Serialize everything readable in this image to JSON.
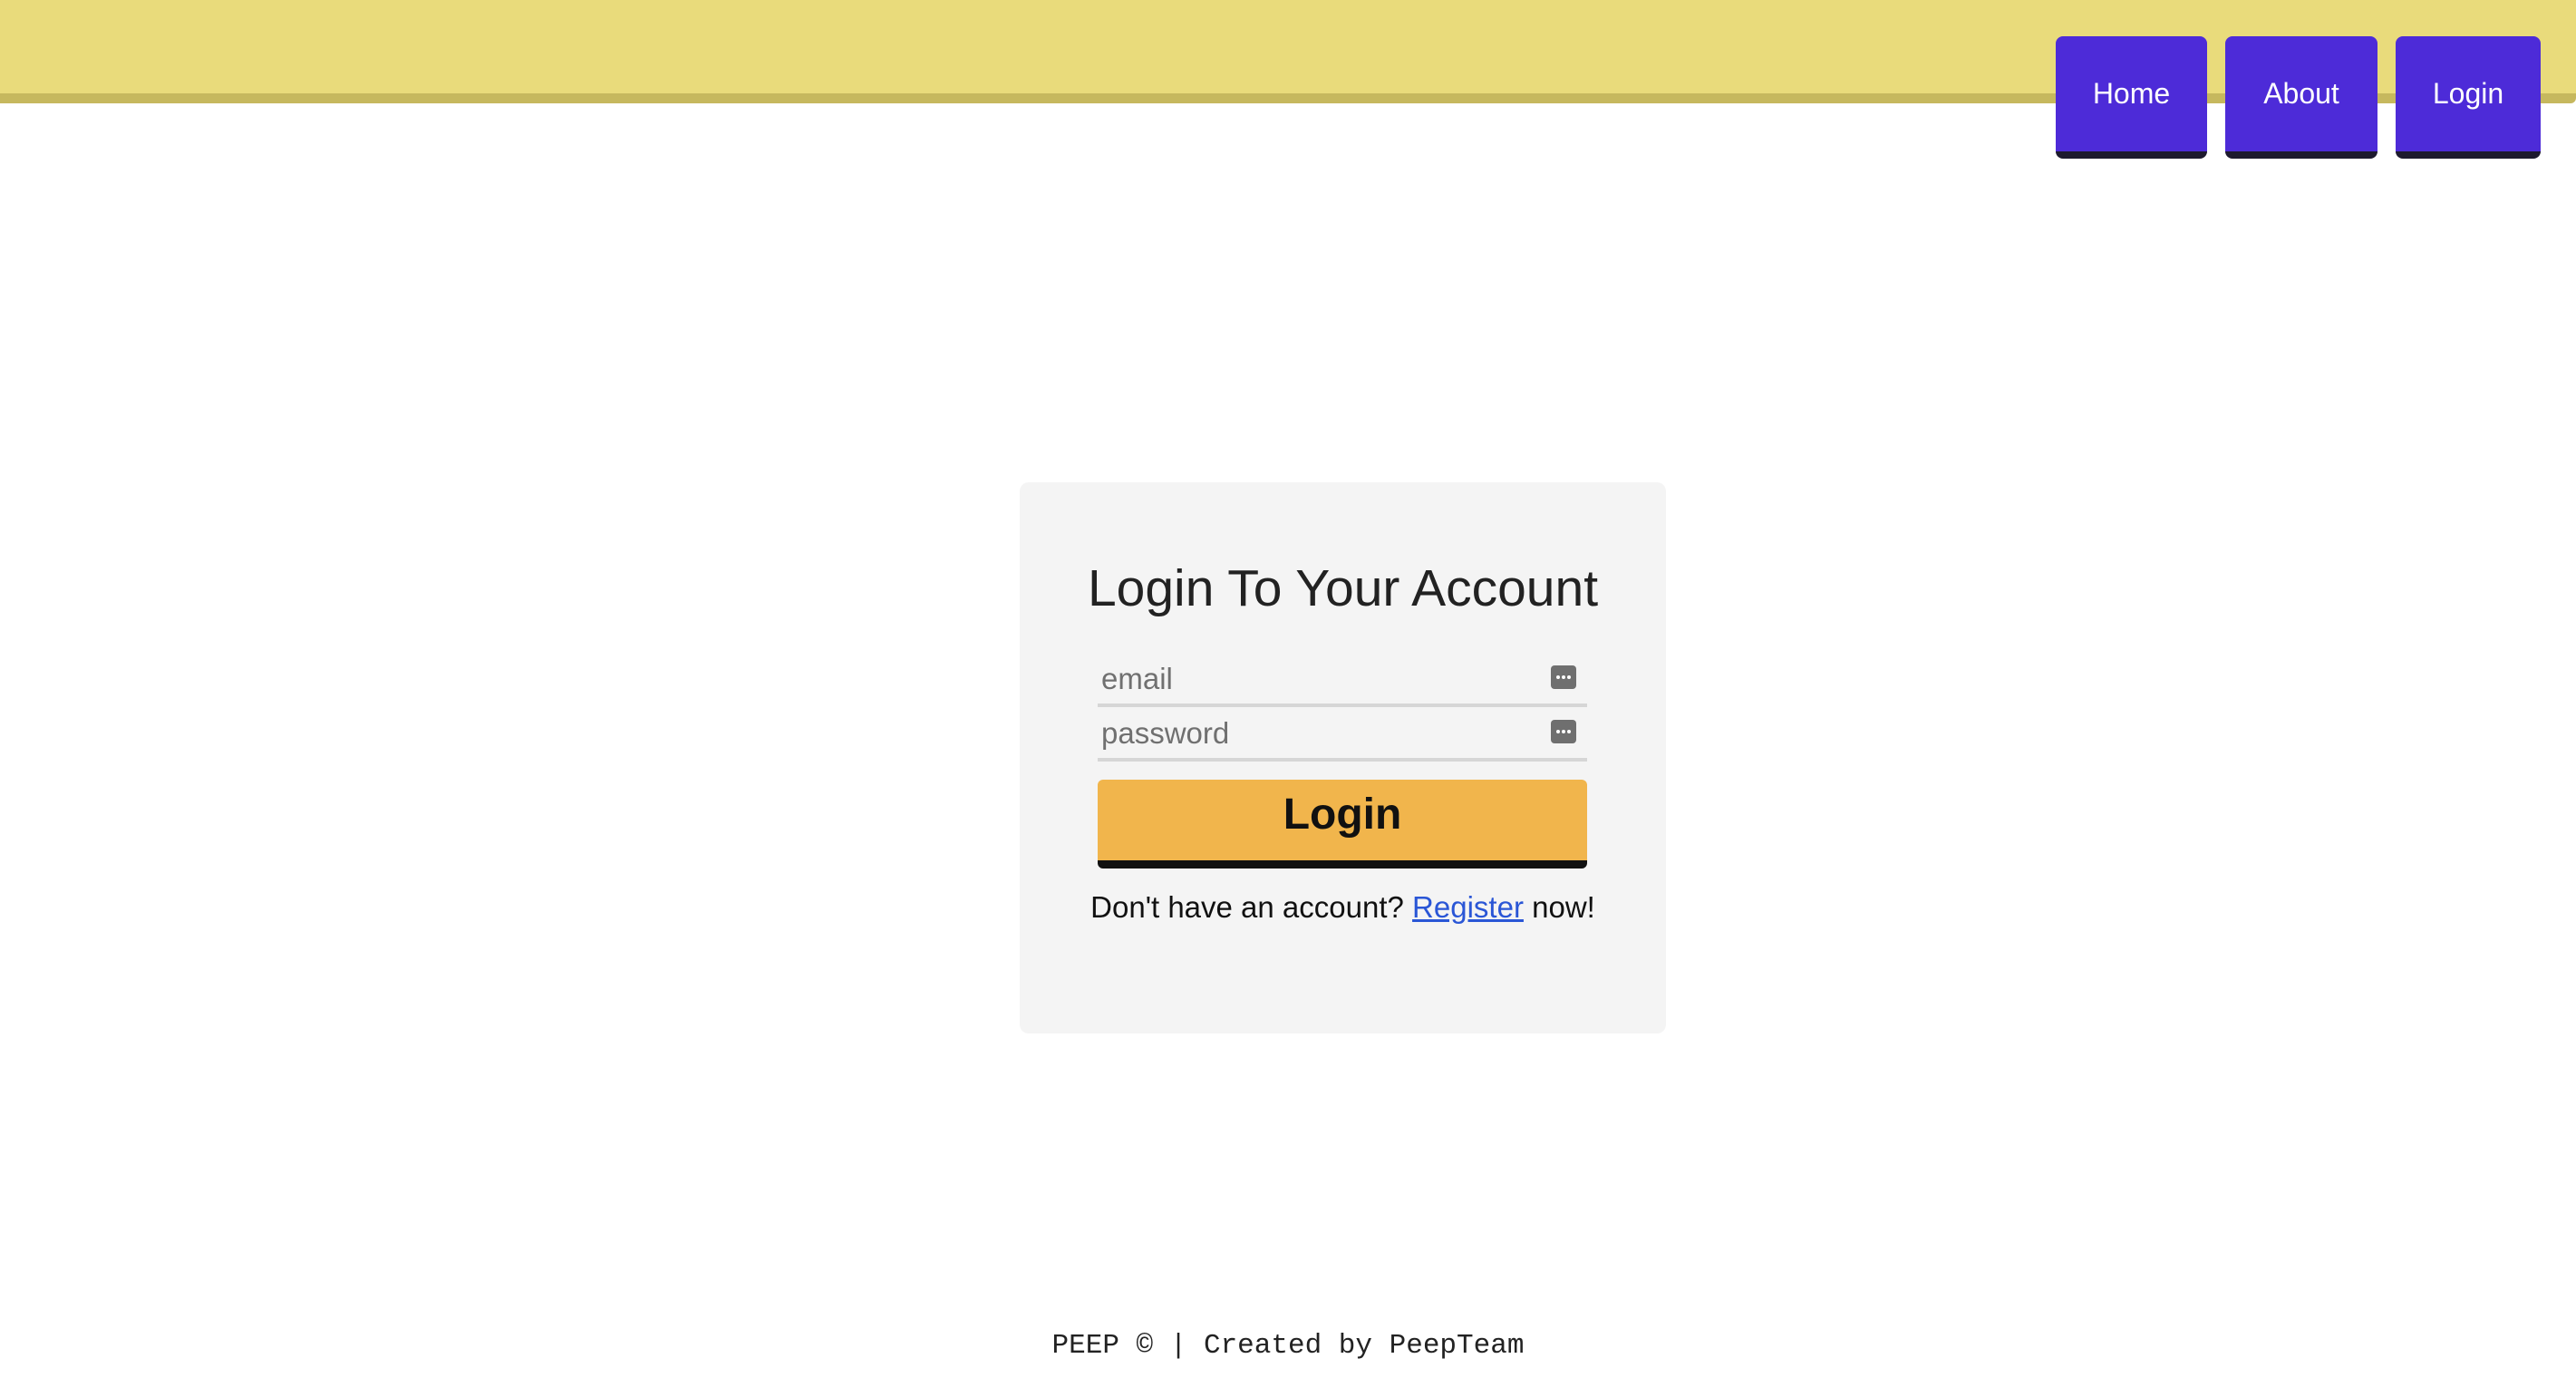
{
  "nav": {
    "home_label": "Home",
    "about_label": "About",
    "login_label": "Login"
  },
  "login_form": {
    "title": "Login To Your Account",
    "email_placeholder": "email",
    "password_placeholder": "password",
    "submit_label": "Login",
    "register_prefix": "Don't have an account?",
    "register_link": "Register",
    "register_suffix": "now!"
  },
  "footer": {
    "text": "PEEP © | Created by PeepTeam"
  },
  "colors": {
    "header_background": "#e9db7b",
    "nav_button": "#4d2bd8",
    "login_button": "#f1b54c",
    "card_background": "#f4f4f4",
    "link": "#2a56d6"
  },
  "icons": {
    "field_autofill": "password-manager-key-icon"
  }
}
